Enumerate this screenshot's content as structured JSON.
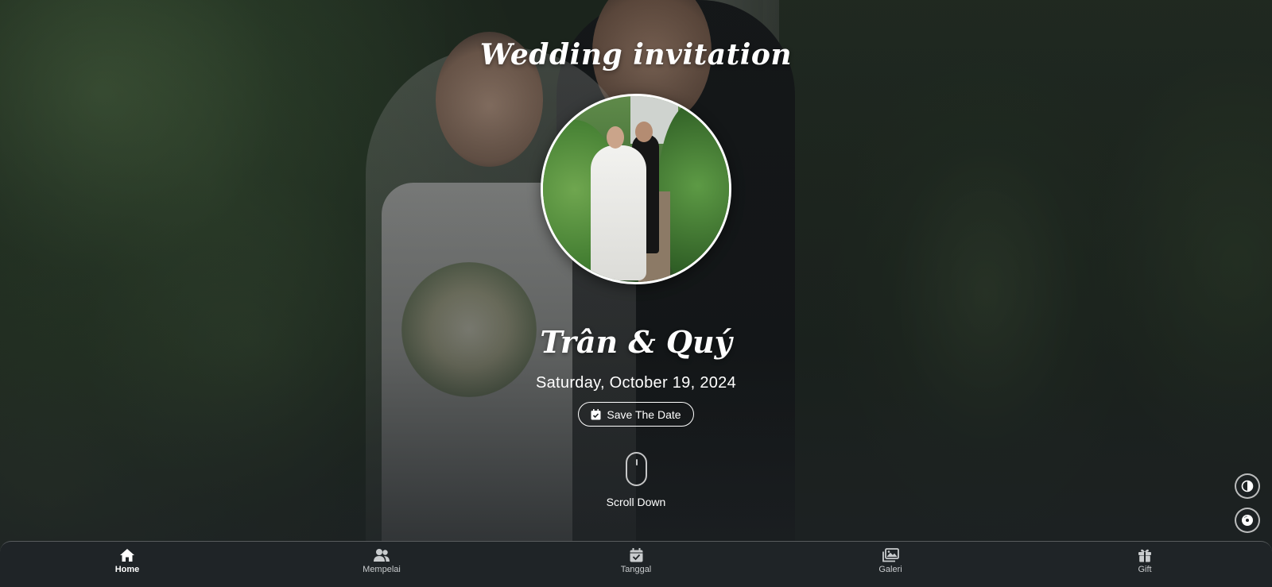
{
  "hero": {
    "title": "Wedding invitation",
    "couple_names": "Trân & Quý",
    "date": "Saturday, October 19, 2024",
    "save_button_label": "Save The Date",
    "scroll_label": "Scroll Down"
  },
  "side_buttons": [
    {
      "icon": "contrast-icon"
    },
    {
      "icon": "music-disc-icon"
    }
  ],
  "bottom_nav": {
    "items": [
      {
        "label": "Home",
        "icon": "home-icon",
        "active": true
      },
      {
        "label": "Mempelai",
        "icon": "users-icon",
        "active": false
      },
      {
        "label": "Tanggal",
        "icon": "calendar-check-icon",
        "active": false
      },
      {
        "label": "Galeri",
        "icon": "images-icon",
        "active": false
      },
      {
        "label": "Gift",
        "icon": "gift-icon",
        "active": false
      }
    ]
  },
  "colors": {
    "background": "#1d2124",
    "text": "#ffffff",
    "nav_bg": "#1f2427"
  }
}
